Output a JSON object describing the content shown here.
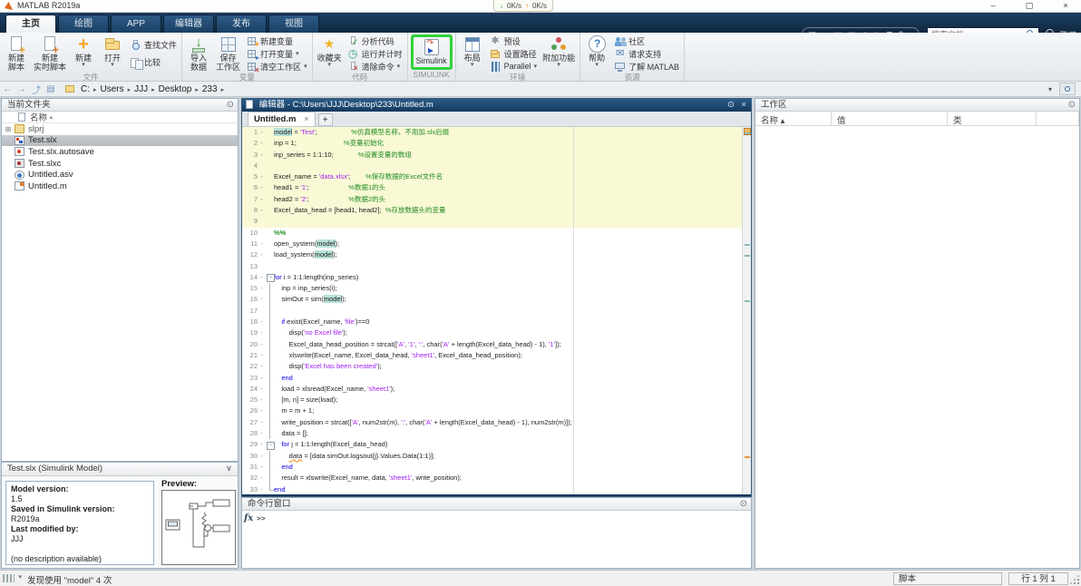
{
  "window": {
    "app_title": "MATLAB R2019a",
    "net_down": "0K/s",
    "net_up": "0K/s",
    "net_down_glyph": "↓",
    "net_up_glyph": "↑",
    "minimize_glyph": "–",
    "maximize_glyph": "▢",
    "close_glyph": "×",
    "search_placeholder": "搜索文档",
    "sign_in_label": "登录"
  },
  "qat_icons": [
    {
      "name": "save-icon",
      "glyph": "▤",
      "dim": false
    },
    {
      "name": "cut-icon",
      "glyph": "✂",
      "dim": true
    },
    {
      "name": "copy-icon",
      "glyph": "▣",
      "dim": true
    },
    {
      "name": "paste-icon",
      "glyph": "▥",
      "dim": true
    },
    {
      "name": "undo-icon",
      "glyph": "↶",
      "dim": true
    },
    {
      "name": "redo-icon",
      "glyph": "↷",
      "dim": true
    },
    {
      "name": "switch-window-icon",
      "glyph": "⊞",
      "dim": false
    },
    {
      "name": "help-icon",
      "glyph": "?",
      "dim": false
    },
    {
      "name": "qat-dropdown-icon",
      "glyph": "▾",
      "dim": false
    }
  ],
  "ribbon_tabs": [
    {
      "label": "主页",
      "active": true
    },
    {
      "label": "绘图",
      "active": false
    },
    {
      "label": "APP",
      "active": false
    },
    {
      "label": "编辑器",
      "active": false
    },
    {
      "label": "发布",
      "active": false
    },
    {
      "label": "视图",
      "active": false
    }
  ],
  "ribbon_groups": [
    {
      "label": "文件",
      "items": [
        {
          "name": "new-script-button",
          "kind": "big",
          "icon": "page-plus",
          "lines": [
            "新建",
            "脚本"
          ]
        },
        {
          "name": "new-live-script-button",
          "kind": "big",
          "icon": "page-live",
          "lines": [
            "新建",
            "实时脚本"
          ]
        },
        {
          "name": "new-button",
          "kind": "big",
          "icon": "plus",
          "lines": [
            "新建"
          ],
          "arrow": true
        },
        {
          "name": "open-button",
          "kind": "big",
          "icon": "folder",
          "lines": [
            "打开"
          ],
          "arrow": true
        },
        {
          "name": "find-files-button",
          "kind": "small",
          "icon": "find",
          "label": "查找文件"
        },
        {
          "name": "compare-button",
          "kind": "small",
          "icon": "compare",
          "label": "比较"
        }
      ]
    },
    {
      "label": "变量",
      "items": [
        {
          "name": "import-data-button",
          "kind": "big",
          "icon": "import",
          "lines": [
            "导入",
            "数据"
          ]
        },
        {
          "name": "save-workspace-button",
          "kind": "big",
          "icon": "grid",
          "lines": [
            "保存",
            "工作区"
          ]
        },
        {
          "name": "new-variable-button",
          "kind": "small",
          "icon": "varnew",
          "label": "新建变量"
        },
        {
          "name": "open-variable-button",
          "kind": "small",
          "icon": "varopen",
          "label": "打开变量",
          "arrow": true
        },
        {
          "name": "clear-workspace-button",
          "kind": "small",
          "icon": "varclear",
          "label": "清空工作区",
          "arrow": true
        }
      ]
    },
    {
      "label": "代码",
      "items": [
        {
          "name": "favorites-button",
          "kind": "big",
          "icon": "fav",
          "lines": [
            "收藏夹"
          ],
          "arrow": true
        },
        {
          "name": "analyze-code-button",
          "kind": "small",
          "icon": "analyze",
          "label": "分析代码"
        },
        {
          "name": "run-and-time-button",
          "kind": "small",
          "icon": "runtime",
          "label": "运行并计时"
        },
        {
          "name": "clear-commands-button",
          "kind": "small",
          "icon": "clear",
          "label": "清除命令",
          "arrow": true
        }
      ]
    },
    {
      "label": "SIMULINK",
      "items": [
        {
          "name": "simulink-button",
          "kind": "big",
          "icon": "simulink",
          "lines": [
            "Simulink"
          ],
          "highlight": true
        }
      ]
    },
    {
      "label": "环境",
      "items": [
        {
          "name": "layout-button",
          "kind": "big",
          "icon": "layout",
          "lines": [
            "布局"
          ],
          "arrow": true
        },
        {
          "name": "preferences-button",
          "kind": "small",
          "icon": "preset",
          "label": "预设"
        },
        {
          "name": "set-path-button",
          "kind": "small",
          "icon": "setpath",
          "label": "设置路径"
        },
        {
          "name": "parallel-button",
          "kind": "small",
          "icon": "parallel",
          "label": "Parallel",
          "arrow": true
        },
        {
          "name": "add-ons-button",
          "kind": "big",
          "icon": "addons",
          "lines": [
            "附加功能"
          ],
          "arrow": true
        }
      ]
    },
    {
      "label": "资源",
      "items": [
        {
          "name": "help-button",
          "kind": "big",
          "icon": "help",
          "lines": [
            "帮助"
          ],
          "arrow": true
        },
        {
          "name": "community-button",
          "kind": "small",
          "icon": "community",
          "label": "社区"
        },
        {
          "name": "request-support-button",
          "kind": "small",
          "icon": "support",
          "label": "请求支持"
        },
        {
          "name": "learn-matlab-button",
          "kind": "small",
          "icon": "learn",
          "label": "了解 MATLAB"
        }
      ]
    }
  ],
  "address": {
    "crumbs": [
      "C:",
      "Users",
      "JJJ",
      "Desktop",
      "233"
    ],
    "separator": "▸",
    "back_glyph": "←",
    "forward_glyph": "→",
    "up_glyph": "⤴",
    "browse_glyph": "▤",
    "dropdown_glyph": "▾"
  },
  "current_folder": {
    "title": "当前文件夹",
    "menu_glyph": "⊙",
    "name_header": "名称",
    "sort_glyph": "▴",
    "files": [
      {
        "label": "slprj",
        "icon": "fi-folder",
        "expander": "⊞",
        "selected": false,
        "dim": true
      },
      {
        "label": "Test.slx",
        "icon": "fi-slx",
        "expander": "",
        "selected": true,
        "dim": false
      },
      {
        "label": "Test.slx.autosave",
        "icon": "fi-autosave",
        "expander": "",
        "selected": false,
        "dim": false
      },
      {
        "label": "Test.slxc",
        "icon": "fi-slxc",
        "expander": "",
        "selected": false,
        "dim": false
      },
      {
        "label": "Untitled.asv",
        "icon": "fi-asv",
        "expander": "",
        "selected": false,
        "dim": false
      },
      {
        "label": "Untitled.m",
        "icon": "fi-m",
        "expander": "",
        "selected": false,
        "dim": false
      }
    ]
  },
  "details": {
    "title": "Test.slx  (Simulink Model)",
    "chevron_glyph": "∨",
    "lines": [
      {
        "text": "Model version:",
        "bold": true
      },
      {
        "text": "1.5",
        "bold": false
      },
      {
        "text": "Saved in Simulink version:",
        "bold": true
      },
      {
        "text": "R2019a",
        "bold": false
      },
      {
        "text": "Last modified by:",
        "bold": true
      },
      {
        "text": "JJJ",
        "bold": false
      },
      {
        "text": "",
        "bold": false
      },
      {
        "text": "(no description available)",
        "bold": false
      }
    ],
    "preview_label": "Preview:"
  },
  "editor": {
    "title": "编辑器 - C:\\Users\\JJJ\\Desktop\\233\\Untitled.m",
    "menu_glyph": "⊙",
    "close_glyph": "×",
    "tab_label": "Untitled.m",
    "tab_close_glyph": "×",
    "new_tab_glyph": "+",
    "code": [
      {
        "n": 1,
        "d": 1,
        "s": 1,
        "t": [
          [
            "hl",
            "model"
          ],
          [
            "p",
            " = "
          ],
          [
            "st",
            "'Test'"
          ],
          [
            "p",
            ";                  "
          ],
          [
            "cm",
            "%仿真模型名称，不用加.slx后缀"
          ]
        ]
      },
      {
        "n": 2,
        "d": 1,
        "s": 1,
        "t": [
          [
            "p",
            "inp = 1;                         "
          ],
          [
            "cm",
            "%变量初始化"
          ]
        ]
      },
      {
        "n": 3,
        "d": 1,
        "s": 1,
        "t": [
          [
            "p",
            "inp_series = 1:1:10;             "
          ],
          [
            "cm",
            "%设置变量的数组"
          ]
        ]
      },
      {
        "n": 4,
        "d": 0,
        "s": 1,
        "t": []
      },
      {
        "n": 5,
        "d": 1,
        "s": 1,
        "t": [
          [
            "p",
            "Excel_name = "
          ],
          [
            "st",
            "'data.xlsx'"
          ],
          [
            "p",
            ";        "
          ],
          [
            "cm",
            "%保存数据的Excel文件名"
          ]
        ]
      },
      {
        "n": 6,
        "d": 1,
        "s": 1,
        "t": [
          [
            "p",
            "head1 = "
          ],
          [
            "st",
            "'1'"
          ],
          [
            "p",
            ";                     "
          ],
          [
            "cm",
            "%数据1的头"
          ]
        ]
      },
      {
        "n": 7,
        "d": 1,
        "s": 1,
        "t": [
          [
            "p",
            "head2 = "
          ],
          [
            "st",
            "'2'"
          ],
          [
            "p",
            ";                     "
          ],
          [
            "cm",
            "%数据2的头"
          ]
        ]
      },
      {
        "n": 8,
        "d": 1,
        "s": 1,
        "t": [
          [
            "p",
            "Excel_data_head = [head1, head2];  "
          ],
          [
            "cm",
            "%存放数据头的变量"
          ]
        ]
      },
      {
        "n": 9,
        "d": 0,
        "s": 1,
        "t": []
      },
      {
        "n": 10,
        "d": 0,
        "t": [
          [
            "sec",
            "%%"
          ]
        ]
      },
      {
        "n": 11,
        "d": 1,
        "t": [
          [
            "p",
            "open_system("
          ],
          [
            "hl",
            "model"
          ],
          [
            "p",
            ");"
          ]
        ]
      },
      {
        "n": 12,
        "d": 1,
        "t": [
          [
            "p",
            "load_system("
          ],
          [
            "hl",
            "model"
          ],
          [
            "p",
            ");"
          ]
        ]
      },
      {
        "n": 13,
        "d": 0,
        "t": []
      },
      {
        "n": 14,
        "d": 1,
        "fold": "open",
        "t": [
          [
            "kw",
            "for"
          ],
          [
            "p",
            " i = 1:1:length(inp_series)"
          ]
        ]
      },
      {
        "n": 15,
        "d": 1,
        "g": 1,
        "t": [
          [
            "p",
            "    inp = inp_series(i);"
          ]
        ]
      },
      {
        "n": 16,
        "d": 1,
        "g": 1,
        "t": [
          [
            "p",
            "    simOut = sim("
          ],
          [
            "hl",
            "model"
          ],
          [
            "p",
            ");"
          ]
        ]
      },
      {
        "n": 17,
        "d": 0,
        "g": 1,
        "t": []
      },
      {
        "n": 18,
        "d": 1,
        "g": 1,
        "t": [
          [
            "p",
            "    "
          ],
          [
            "kw",
            "if"
          ],
          [
            "p",
            " exist(Excel_name, "
          ],
          [
            "st",
            "'file'"
          ],
          [
            "p",
            ")==0"
          ]
        ]
      },
      {
        "n": 19,
        "d": 1,
        "g": 1,
        "t": [
          [
            "p",
            "        disp("
          ],
          [
            "st",
            "'no Excel file'"
          ],
          [
            "p",
            ");"
          ]
        ]
      },
      {
        "n": 20,
        "d": 1,
        "g": 1,
        "t": [
          [
            "p",
            "        Excel_data_head_position = strcat(["
          ],
          [
            "st",
            "'A'"
          ],
          [
            "p",
            ", "
          ],
          [
            "st",
            "'1'"
          ],
          [
            "p",
            ", "
          ],
          [
            "st",
            "':'"
          ],
          [
            "p",
            ", char("
          ],
          [
            "st",
            "'A'"
          ],
          [
            "p",
            " + length(Excel_data_head) - 1), "
          ],
          [
            "st",
            "'1'"
          ],
          [
            "p",
            "]);"
          ]
        ]
      },
      {
        "n": 21,
        "d": 1,
        "g": 1,
        "t": [
          [
            "p",
            "        xlswrite(Excel_name, Excel_data_head, "
          ],
          [
            "st",
            "'sheet1'"
          ],
          [
            "p",
            ", Excel_data_head_position);"
          ]
        ]
      },
      {
        "n": 22,
        "d": 1,
        "g": 1,
        "t": [
          [
            "p",
            "        disp("
          ],
          [
            "st",
            "'Excel has been created'"
          ],
          [
            "p",
            ");"
          ]
        ]
      },
      {
        "n": 23,
        "d": 1,
        "g": 1,
        "t": [
          [
            "p",
            "    "
          ],
          [
            "kw",
            "end"
          ]
        ]
      },
      {
        "n": 24,
        "d": 1,
        "g": 1,
        "t": [
          [
            "p",
            "    load = xlsread(Excel_name, "
          ],
          [
            "st",
            "'sheet1'"
          ],
          [
            "p",
            ");"
          ]
        ]
      },
      {
        "n": 25,
        "d": 1,
        "g": 1,
        "t": [
          [
            "p",
            "    [m, n] = size(load);"
          ]
        ]
      },
      {
        "n": 26,
        "d": 1,
        "g": 1,
        "t": [
          [
            "p",
            "    m = m + 1;"
          ]
        ]
      },
      {
        "n": 27,
        "d": 1,
        "g": 1,
        "t": [
          [
            "p",
            "    write_position = strcat(["
          ],
          [
            "st",
            "'A'"
          ],
          [
            "p",
            ", num2str(m), "
          ],
          [
            "st",
            "':'"
          ],
          [
            "p",
            ", char("
          ],
          [
            "st",
            "'A'"
          ],
          [
            "p",
            " + length(Excel_data_head) - 1), num2str(m)]);"
          ]
        ]
      },
      {
        "n": 28,
        "d": 1,
        "g": 1,
        "t": [
          [
            "p",
            "    data = [];"
          ]
        ]
      },
      {
        "n": 29,
        "d": 1,
        "fold": "open",
        "g": 1,
        "t": [
          [
            "p",
            "    "
          ],
          [
            "kw",
            "for"
          ],
          [
            "p",
            " j = 1:1:length(Excel_data_head)"
          ]
        ]
      },
      {
        "n": 30,
        "d": 1,
        "g": 1,
        "t": [
          [
            "p",
            "        "
          ],
          [
            "wa",
            "data"
          ],
          [
            "p",
            " = [data simOut.logsout{j}.Values.Data(1:1)];"
          ]
        ]
      },
      {
        "n": 31,
        "d": 1,
        "g": 1,
        "t": [
          [
            "p",
            "    "
          ],
          [
            "kw",
            "end"
          ]
        ]
      },
      {
        "n": 32,
        "d": 1,
        "g": 1,
        "t": [
          [
            "p",
            "    result = xlswrite(Excel_name, data, "
          ],
          [
            "st",
            "'sheet1'"
          ],
          [
            "p",
            ", write_position);"
          ]
        ]
      },
      {
        "n": 33,
        "d": 1,
        "fold": "end",
        "t": [
          [
            "kw",
            "end"
          ]
        ]
      }
    ],
    "scroll_marks": [
      {
        "line": 1,
        "kind": "occurrence"
      },
      {
        "line": 11,
        "kind": "occurrence"
      },
      {
        "line": 12,
        "kind": "occurrence"
      },
      {
        "line": 16,
        "kind": "occurrence"
      },
      {
        "line": 30,
        "kind": "warning"
      }
    ]
  },
  "command_window": {
    "title": "命令行窗口",
    "menu_glyph": "⊙",
    "fx_label": "fx",
    "prompt": ">>"
  },
  "workspace": {
    "title": "工作区",
    "menu_glyph": "⊙",
    "columns": [
      "名称",
      "值",
      "类"
    ],
    "sort_glyph": "▴",
    "rows": []
  },
  "statusbar": {
    "left_text": "发现使用 \"model\" 4 次",
    "file_type": "脚本",
    "line_label": "行",
    "line": "1",
    "col_label": "列",
    "col": "1"
  },
  "colors": {
    "ribbon_navy": "#16395c",
    "active_section_bg": "#f9f9d6",
    "simulink_highlight": "#2fd33a",
    "keyword": "#0d00e6",
    "string": "#a020f0",
    "comment": "#228b22",
    "occurrence_highlight": "#b9e2da"
  }
}
